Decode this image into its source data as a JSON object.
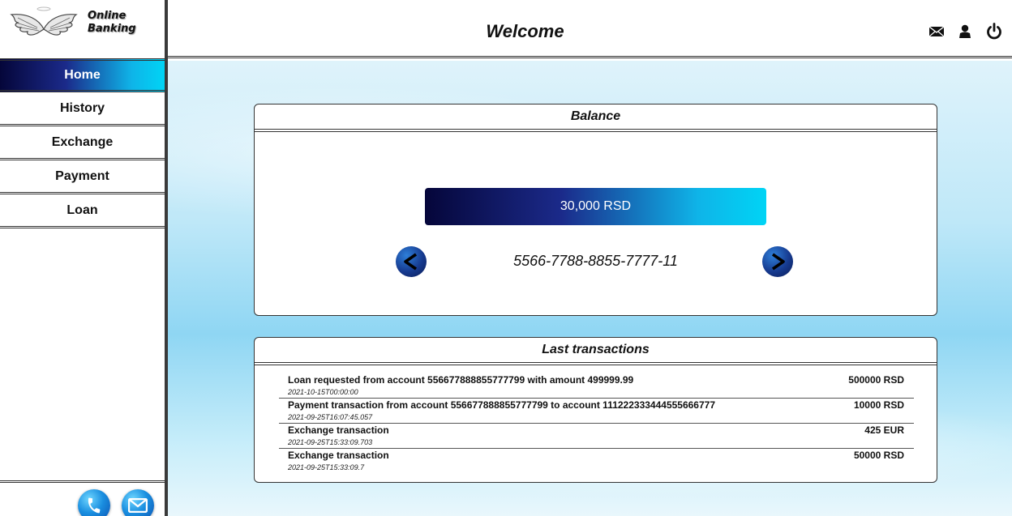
{
  "logo": {
    "line1": "Online",
    "line2": "Banking"
  },
  "nav": {
    "items": [
      {
        "label": "Home",
        "active": true
      },
      {
        "label": "History",
        "active": false
      },
      {
        "label": "Exchange",
        "active": false
      },
      {
        "label": "Payment",
        "active": false
      },
      {
        "label": "Loan",
        "active": false
      }
    ]
  },
  "header": {
    "title": "Welcome",
    "icons": [
      "mail-icon",
      "user-icon",
      "power-icon"
    ]
  },
  "footer": {
    "icons": [
      "phone-icon",
      "mail-icon"
    ]
  },
  "balance": {
    "title": "Balance",
    "amount": "30,000 RSD",
    "account_number": "5566-7788-8855-7777-11"
  },
  "transactions": {
    "title": "Last transactions",
    "items": [
      {
        "description": "Loan requested from account 556677888855777799 with amount 499999.99",
        "date": "2021-10-15T00:00:00",
        "amount": "500000 RSD"
      },
      {
        "description": "Payment transaction from account 556677888855777799 to account 111222333444555666777",
        "date": "2021-09-25T16:07:45.057",
        "amount": "10000 RSD"
      },
      {
        "description": "Exchange transaction",
        "date": "2021-09-25T15:33:09.703",
        "amount": "425 EUR"
      },
      {
        "description": "Exchange transaction",
        "date": "2021-09-25T15:33:09.7",
        "amount": "50000 RSD"
      }
    ]
  },
  "colors": {
    "accent_dark": "#05063a",
    "accent_light": "#00d4f5",
    "background_sky": "#8fd6f3"
  }
}
